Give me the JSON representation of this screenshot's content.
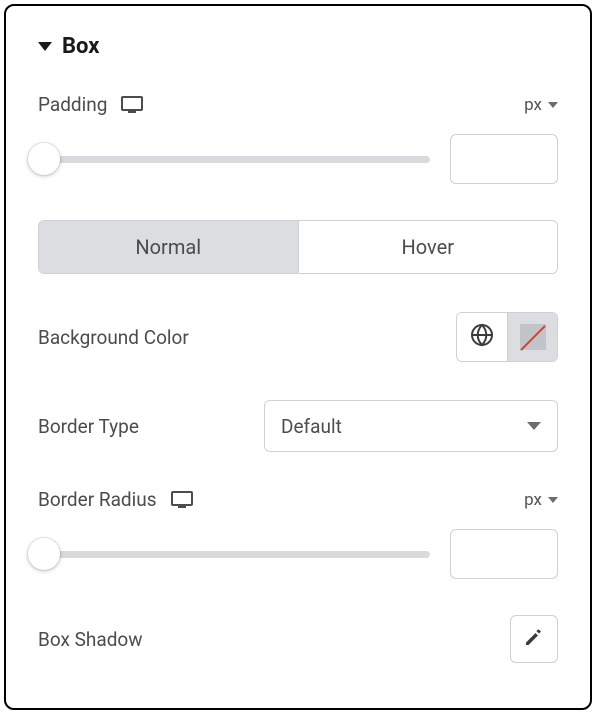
{
  "section": {
    "title": "Box"
  },
  "padding": {
    "label": "Padding",
    "unit": "px",
    "value": ""
  },
  "tabs": {
    "normal": "Normal",
    "hover": "Hover",
    "active": "normal"
  },
  "backgroundColor": {
    "label": "Background Color"
  },
  "borderType": {
    "label": "Border Type",
    "value": "Default"
  },
  "borderRadius": {
    "label": "Border Radius",
    "unit": "px",
    "value": ""
  },
  "boxShadow": {
    "label": "Box Shadow"
  }
}
